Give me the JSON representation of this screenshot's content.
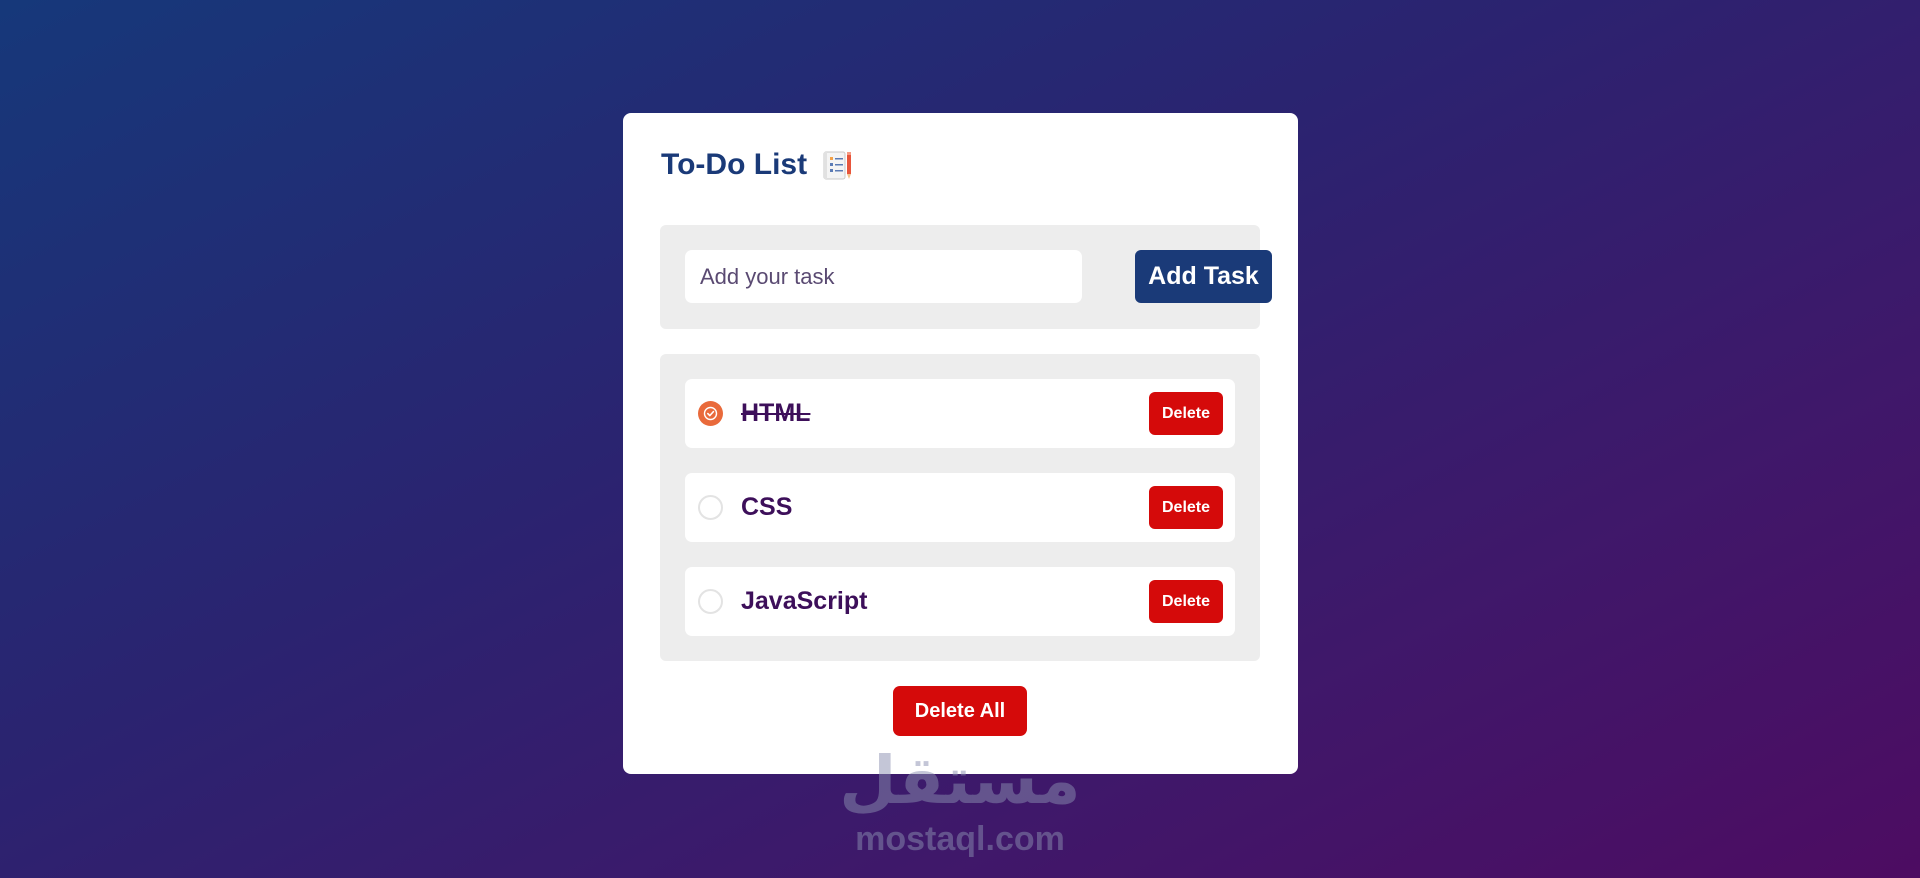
{
  "app": {
    "title": "To-Do List",
    "title_icon": "notepad-icon"
  },
  "input": {
    "placeholder": "Add your task",
    "value": "",
    "add_label": "Add Task"
  },
  "tasks": [
    {
      "text": "HTML",
      "completed": true,
      "delete_label": "Delete"
    },
    {
      "text": "CSS",
      "completed": false,
      "delete_label": "Delete"
    },
    {
      "text": "JavaScript",
      "completed": false,
      "delete_label": "Delete"
    }
  ],
  "delete_all_label": "Delete All",
  "watermark": {
    "arabic": "مستقل",
    "latin": "mostaql.com"
  },
  "colors": {
    "primary": "#1a3a78",
    "danger": "#d50a0a",
    "checked": "#e96a3b",
    "task_text": "#3d0f5a",
    "panel": "#ededed"
  }
}
